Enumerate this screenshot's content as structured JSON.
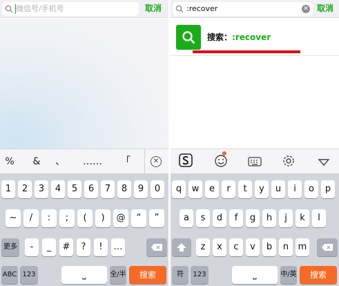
{
  "left": {
    "search": {
      "placeholder": "微信号/手机号"
    },
    "cancel_label": "取消",
    "symbol_row": [
      "%",
      "&",
      "、",
      "……",
      "「"
    ],
    "keys_row1": [
      "1",
      "2",
      "3",
      "4",
      "5",
      "6",
      "7",
      "8",
      "9",
      "0"
    ],
    "keys_row2": [
      "~",
      "/",
      ":",
      ";",
      "(",
      ")",
      "@",
      "“",
      "”"
    ],
    "keys_row3": {
      "more": "更多",
      "items": [
        "-",
        "_",
        "#",
        "?",
        "!",
        "…"
      ]
    },
    "keys_row4": {
      "abc": "ABC",
      "num": "123",
      "space": "⎵",
      "width_toggle": "全/半",
      "search": "搜索"
    }
  },
  "right": {
    "search": {
      "value": ":recover"
    },
    "cancel_label": "取消",
    "result": {
      "prefix": "搜索：",
      "query": ":recover"
    },
    "keys_row1": [
      "q",
      "w",
      "e",
      "r",
      "t",
      "y",
      "u",
      "i",
      "o",
      "p"
    ],
    "keys_row2": [
      "a",
      "s",
      "d",
      "f",
      "g",
      "h",
      "j",
      "k",
      "l"
    ],
    "keys_row3": [
      "z",
      "x",
      "c",
      "v",
      "b",
      "n",
      "m"
    ],
    "keys_row4": {
      "symbol": "符",
      "num": "123",
      "space": "⎵",
      "lang_toggle": "中/英",
      "search": "搜索"
    }
  },
  "colors": {
    "wechat_green": "#1aad19",
    "highlight_red": "#e60012",
    "search_key_orange": "#f56a26"
  },
  "icons": [
    "search-icon",
    "clear-icon",
    "sogou-logo-icon",
    "emoji-icon",
    "keyboard-icon",
    "gear-icon",
    "chevron-down-icon",
    "backspace-icon",
    "shift-icon"
  ]
}
